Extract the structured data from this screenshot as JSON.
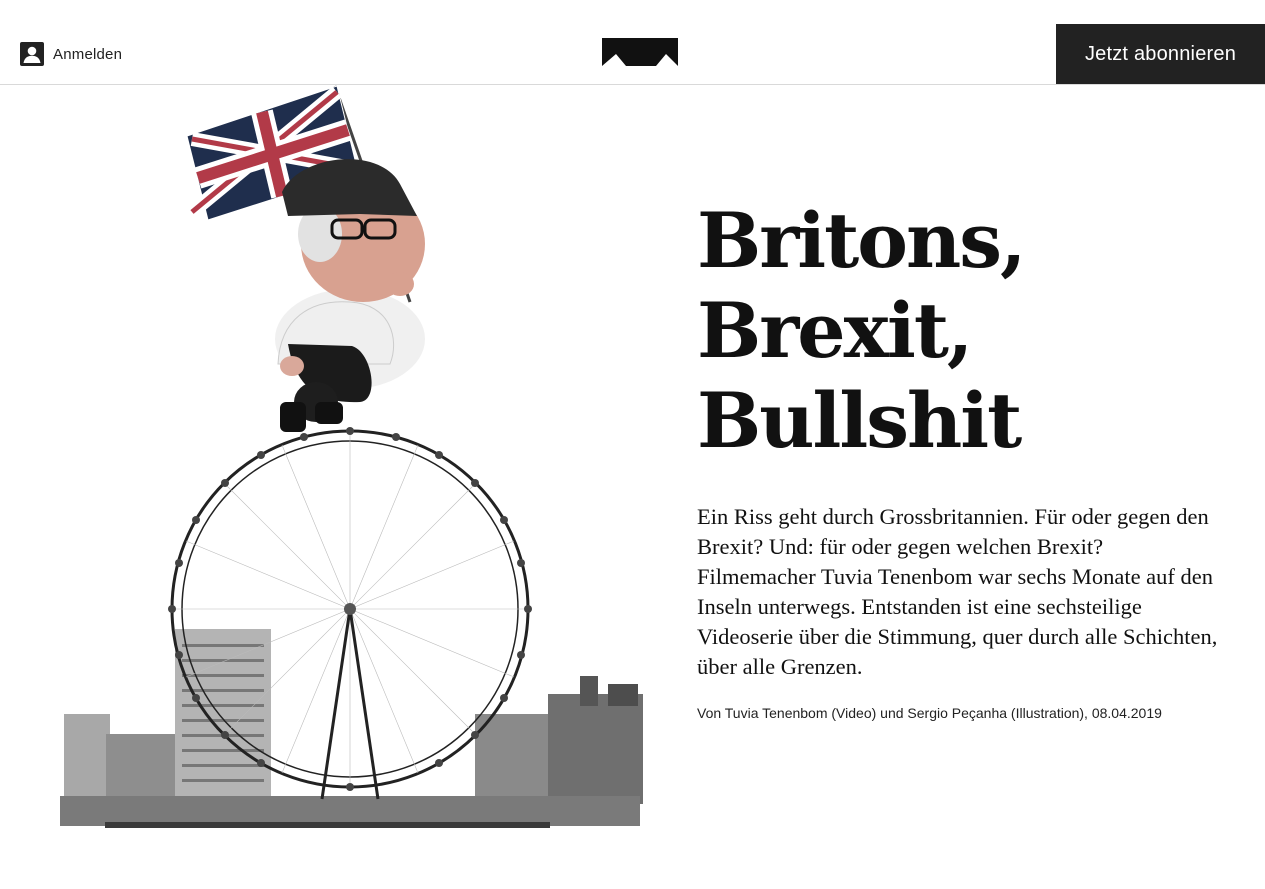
{
  "header": {
    "login_label": "Anmelden",
    "subscribe_label": "Jetzt abonnieren",
    "login_icon": "user-icon",
    "logo_icon": "republik-logo-icon"
  },
  "article": {
    "title_lines": [
      "Britons,",
      "Brexit,",
      "Bullshit"
    ],
    "lead": "Ein Riss geht durch Grossbritannien. Für oder gegen den Brexit? Und: für oder gegen welchen Brexit? Filmemacher Tuvia Tenenbom war sechs Monate auf den Inseln unterwegs. Entstanden ist eine sechsteilige Videoserie über die Stimmung, quer durch alle Schichten, über alle Grenzen.",
    "byline": "Von Tuvia Tenenbom (Video) und Sergio Peçanha (Illustration), 08.04.2019"
  },
  "colors": {
    "button_bg": "#222222",
    "button_text": "#ffffff",
    "text": "#111111",
    "divider": "#d9d9d9"
  }
}
